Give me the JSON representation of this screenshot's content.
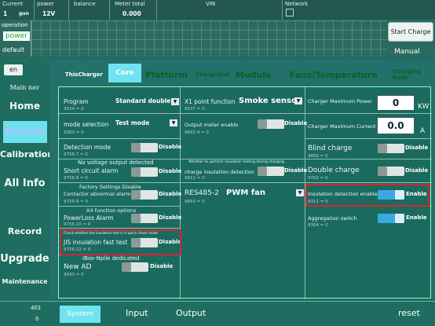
{
  "header": {
    "current_label": "Current",
    "current_gun": "1",
    "gun_unit": "gun",
    "power_label": "power",
    "power_val": "12V",
    "balance_label": "balance",
    "meter_label": "Meter total",
    "meter_val": "0.000",
    "vin_label": "VIN",
    "network_label": "Network"
  },
  "opmode": {
    "label": "operation",
    "mode": "power",
    "default": "default"
  },
  "top_right": {
    "start": "Start Charge",
    "mode": "Manual"
  },
  "lang": "en",
  "sidebar": {
    "title": "Main nav",
    "items": [
      "Home",
      "Dev Param",
      "Calibration",
      "All Info",
      "Record",
      "Upgrade",
      "Maintenance"
    ],
    "active": "Dev Param"
  },
  "tabs": [
    {
      "label": "ThisCharger"
    },
    {
      "label": "Core",
      "active": true
    },
    {
      "label": "Platform"
    },
    {
      "label": "ChargeGun"
    },
    {
      "label": "Module"
    },
    {
      "label": "Fans/Temperature"
    },
    {
      "label": "Charging Rack"
    }
  ],
  "col1": {
    "program": {
      "label": "Program",
      "value": "Standard double p",
      "code": "9524 = 0"
    },
    "mode": {
      "label": "mode selection",
      "value": "Test mode",
      "code": "9303 = 0"
    },
    "detection": {
      "label": "Detection mode",
      "state": "Disable",
      "code": "9756.7 = 0"
    },
    "nvo": {
      "label": "No voltage output detected"
    },
    "short": {
      "label": "Short circuit alarm",
      "state": "Disable",
      "code": "9756.8 = 0"
    },
    "factory": {
      "label": "Factory Settings Disable"
    },
    "contactor": {
      "label": "Contactor abnormal alarm",
      "state": "Disable",
      "code": "9759.9 = 0"
    },
    "x4": {
      "label": "X4 function options"
    },
    "powerloss": {
      "label": "PowerLoss Alarm",
      "state": "Disable",
      "code": "9756.10 = 0"
    },
    "quickcheck": {
      "label": "Check whether the insulation test is in quick check mode"
    },
    "jis": {
      "label": "JIS insulation fast test",
      "state": "Disable",
      "code": "9756.12 = 0"
    },
    "ibox": {
      "label": "IBox-Npile dedicated"
    },
    "newad": {
      "label": "New AD",
      "state": "Disable",
      "code": "9543 = 0"
    }
  },
  "col2": {
    "x1": {
      "label": "X1 point function",
      "value": "Smoke senso",
      "code": "9537 = 0"
    },
    "meter": {
      "label": "Output meter enable",
      "state": "Disable",
      "code": "9891.4 = 0"
    },
    "ins_note": {
      "label": "Whether to perform insulation testing during charging"
    },
    "chg_ins": {
      "label": "charge insulation detection",
      "state": "Disable",
      "code": "9811 = 0"
    },
    "res": {
      "label": "RES485-2",
      "value": "PWM fan",
      "code": "9893 = 0"
    }
  },
  "col3": {
    "maxpower": {
      "label": "Charger Maximum Power",
      "value": "0",
      "unit": "KW"
    },
    "maxcurrent": {
      "label": "Charger Maximum Current",
      "value": "0.0",
      "unit": "A"
    },
    "blind": {
      "label": "Blind charge",
      "state": "Disable",
      "code": "9895 = 0"
    },
    "double": {
      "label": "Double charge",
      "state": "Disable",
      "code": "9762 = 0"
    },
    "insdet": {
      "label": "Insulation detection enable",
      "state": "Enable",
      "code": "9311 = 0"
    },
    "agg": {
      "label": "Aggregation switch",
      "state": "Enable",
      "code": "9304 = 0"
    }
  },
  "counters": {
    "a": "401",
    "b": "0"
  },
  "bottom": {
    "tabs": [
      "System",
      "Input",
      "Output"
    ],
    "reset": "reset"
  }
}
